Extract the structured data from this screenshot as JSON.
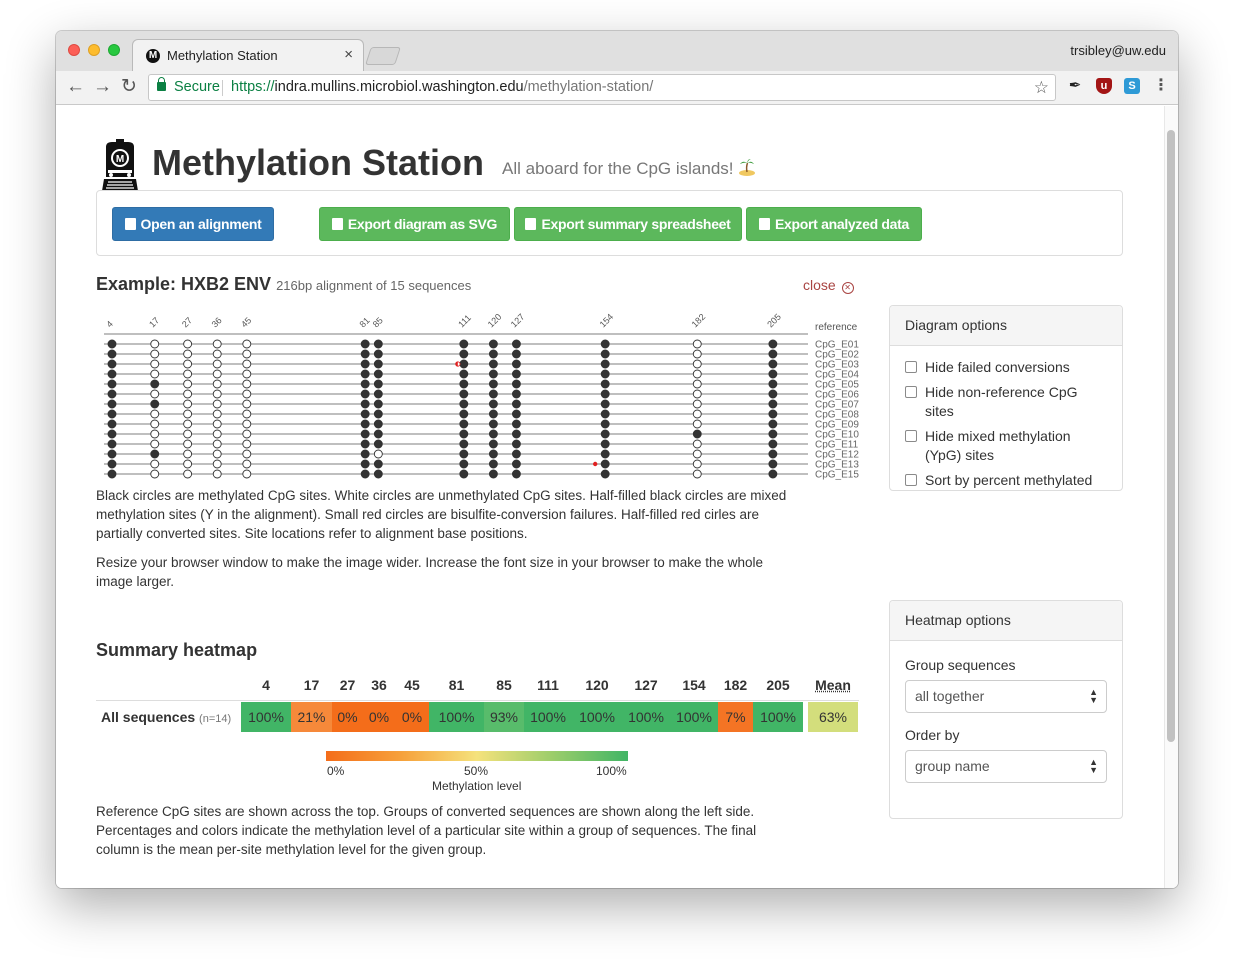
{
  "browser": {
    "tab_title": "Methylation Station",
    "tab_close": "×",
    "user_email": "trsibley@uw.edu",
    "secure_label": "Secure",
    "url_scheme": "https://",
    "url_host": "indra.mullins.microbiol.washington.edu",
    "url_path": "/methylation-station/"
  },
  "header": {
    "title": "Methylation Station",
    "tagline": "All aboard for the CpG islands!"
  },
  "toolbar": {
    "open_label": "Open an alignment",
    "export_svg_label": "Export diagram as SVG",
    "export_summary_label": "Export summary spreadsheet",
    "export_data_label": "Export analyzed data"
  },
  "example": {
    "title": "Example: HXB2 ENV",
    "subtitle": "216bp alignment of 15 sequences",
    "close_label": "close"
  },
  "diagram": {
    "sites": [
      4,
      17,
      27,
      36,
      45,
      81,
      85,
      111,
      120,
      127,
      154,
      182,
      205
    ],
    "site_labels": [
      "4",
      "17",
      "27",
      "36",
      "45",
      "81",
      "85",
      "111",
      "120",
      "127",
      "154",
      "182",
      "205"
    ],
    "reference_label": "reference",
    "sequences": [
      "CpG_E01",
      "CpG_E02",
      "CpG_E03",
      "CpG_E04",
      "CpG_E05",
      "CpG_E06",
      "CpG_E07",
      "CpG_E08",
      "CpG_E09",
      "CpG_E10",
      "CpG_E11",
      "CpG_E12",
      "CpG_E13",
      "CpG_E15"
    ],
    "methylation": [
      "B W W W W B B B B B B W B",
      "B W W W W B B B B B B W B",
      "B W W W W B B B B B B W B",
      "B W W W W B B B B B B W B",
      "B B W W W B B B B B B W B",
      "B W W W W B B B B B B W B",
      "B B W W W B B B B B B W B",
      "B W W W W B B B B B B W B",
      "B W W W W B B B B B B W B",
      "B W W W W B B B B B B B B",
      "B W W W W B B B B B B W B",
      "B B W W W B W B B B B W B",
      "B W W W W B B B B B B W B",
      "B W W W W B B B B B B W B"
    ],
    "failures": [
      {
        "row": 2,
        "site": 111,
        "kind": "half"
      },
      {
        "row": 12,
        "site": 154,
        "kind": "dot"
      }
    ],
    "colors": {
      "methylated": "#333333",
      "failure": "#e02020"
    }
  },
  "description": {
    "p1": "Black circles are methylated CpG sites. White circles are unmethylated CpG sites. Half-filled black circles are mixed methylation sites (Y in the alignment). Small red circles are bisulfite-conversion failures. Half-filled red cirles are partially converted sites. Site locations refer to alignment base positions.",
    "p2": "Resize your browser window to make the image wider. Increase the font size in your browser to make the whole image larger."
  },
  "diagram_options": {
    "title": "Diagram options",
    "options": [
      "Hide failed conversions",
      "Hide non-reference CpG sites",
      "Hide mixed methylation (YpG) sites",
      "Sort by percent methylated"
    ]
  },
  "heatmap": {
    "title": "Summary heatmap",
    "columns": [
      "4",
      "17",
      "27",
      "36",
      "45",
      "81",
      "85",
      "111",
      "120",
      "127",
      "154",
      "182",
      "205"
    ],
    "mean_label": "Mean",
    "row_label": "All sequences",
    "row_n": "(n=14)",
    "values": [
      "100%",
      "21%",
      "0%",
      "0%",
      "0%",
      "100%",
      "93%",
      "100%",
      "100%",
      "100%",
      "100%",
      "7%",
      "100%"
    ],
    "mean_value": "63%",
    "cell_colors": [
      "#41b566",
      "#f6893a",
      "#f46d1a",
      "#f46d1a",
      "#f46d1a",
      "#41b566",
      "#58bc6b",
      "#41b566",
      "#41b566",
      "#41b566",
      "#41b566",
      "#f47424",
      "#41b566"
    ],
    "mean_color": "#d3de7c",
    "legend_min": "0%",
    "legend_mid": "50%",
    "legend_max": "100%",
    "legend_title": "Methylation level",
    "description": "Reference CpG sites are shown across the top. Groups of converted sequences are shown along the left side. Percentages and colors indicate the methylation level of a particular site within a group of sequences. The final column is the mean per-site methylation level for the given group."
  },
  "heatmap_options": {
    "title": "Heatmap options",
    "group_label": "Group sequences",
    "group_value": "all together",
    "order_label": "Order by",
    "order_value": "group name"
  }
}
